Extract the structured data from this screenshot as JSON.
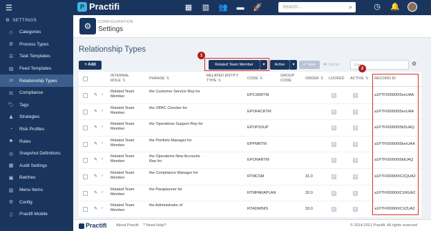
{
  "app": {
    "name": "Practifi"
  },
  "search": {
    "placeholder": "Search..."
  },
  "sidebar": {
    "heading": "SETTINGS",
    "items": [
      {
        "label": "Categories",
        "icon": "categories-icon",
        "glyph": "◇",
        "active": false
      },
      {
        "label": "Process Types",
        "icon": "process-icon",
        "glyph": "⚙",
        "active": false
      },
      {
        "label": "Task Templates",
        "icon": "task-icon",
        "glyph": "☰",
        "active": false
      },
      {
        "label": "Feed Templates",
        "icon": "feed-icon",
        "glyph": "▤",
        "active": false
      },
      {
        "label": "Relationship Types",
        "icon": "relationship-icon",
        "glyph": "⇄",
        "active": true
      },
      {
        "label": "Compliance",
        "icon": "compliance-icon",
        "glyph": "⚖",
        "active": false
      },
      {
        "label": "Tags",
        "icon": "tag-icon",
        "glyph": "🏷",
        "active": false
      },
      {
        "label": "Strategies",
        "icon": "strategies-icon",
        "glyph": "♟",
        "active": false
      },
      {
        "label": "Risk Profiles",
        "icon": "risk-icon",
        "glyph": "◔",
        "active": false
      },
      {
        "label": "Rules",
        "icon": "rules-icon",
        "glyph": "⚑",
        "active": false
      },
      {
        "label": "Snapshot Definitions",
        "icon": "snapshot-icon",
        "glyph": "◎",
        "active": false
      },
      {
        "label": "Audit Settings",
        "icon": "audit-icon",
        "glyph": "▦",
        "active": false
      },
      {
        "label": "Batches",
        "icon": "batches-icon",
        "glyph": "▣",
        "active": false
      },
      {
        "label": "Menu Items",
        "icon": "menu-items-icon",
        "glyph": "▥",
        "active": false
      },
      {
        "label": "Config",
        "icon": "config-icon",
        "glyph": "⚙",
        "active": false
      },
      {
        "label": "Practifi Mobile",
        "icon": "mobile-icon",
        "glyph": "▯",
        "active": false
      }
    ]
  },
  "page": {
    "breadcrumb": "CONFIGURATION",
    "title": "Settings",
    "section_title": "Relationship Types"
  },
  "toolbar": {
    "add_label": "+ Add",
    "type_filter": "Related Team Member",
    "active_filter": "Active",
    "save_label": "✔ Save",
    "cancel_label": "✖ Cancel",
    "filter_placeholder": "Filter..."
  },
  "callouts": [
    "1",
    "2"
  ],
  "table": {
    "headers": {
      "internal_role": "INTERNAL ROLE",
      "phrase": "PHRASE",
      "related_entity_type": "RELATED ENTITY TYPE",
      "code": "CODE",
      "group_code": "GROUP CODE",
      "order": "ORDER",
      "locked": "LOCKED",
      "active": "ACTIVE",
      "record_id": "RECORD ID"
    },
    "rows": [
      {
        "internal_role": "Related Team Member",
        "phrase": "the Customer Service Rep for",
        "code": "EPCSRRTM",
        "order": "",
        "record_id": "a1P7F000000I5ezUAA"
      },
      {
        "internal_role": "Related Team Member",
        "phrase": "the OPAC Checker for",
        "code": "EPOFACRTM",
        "order": "",
        "record_id": "a1P7F000000I5exUAA"
      },
      {
        "internal_role": "Related Team Member",
        "phrase": "the Operations Support Rep for",
        "code": "EPOPSSUP",
        "order": "",
        "record_id": "a1P7F000000I5k5UAQ"
      },
      {
        "internal_role": "Related Team Member",
        "phrase": "the Portfolio Manager for",
        "code": "EPPMRTM",
        "order": "",
        "record_id": "a1P7F000000I5kmUAA"
      },
      {
        "internal_role": "Related Team Member",
        "phrase": "the Operations New Accounts Rep for",
        "code": "EPONARTM",
        "order": "",
        "record_id": "a1P7F000000I5ktUAQ"
      },
      {
        "internal_role": "Related Team Member",
        "phrase": "the Compliance Manager for",
        "code": "RTMCSM",
        "order": "31.0",
        "record_id": "a1P7F000000ICXQUA2"
      },
      {
        "internal_role": "Related Team Member",
        "phrase": "the Paraplanner for",
        "code": "RTMPARAPLAN",
        "order": "32.0",
        "record_id": "a1P7F000000ICXRUA2"
      },
      {
        "internal_role": "Related Team Member",
        "phrase": "the Administrator of",
        "code": "RTADMINIS",
        "order": "33.0",
        "record_id": "a1P7F000000ICXZUA2"
      }
    ]
  },
  "footer": {
    "logo": "Practifi",
    "about": "About Practifi",
    "help": "Need Help?",
    "copyright": "© 2014-2021 Practifi. All rights reserved"
  }
}
